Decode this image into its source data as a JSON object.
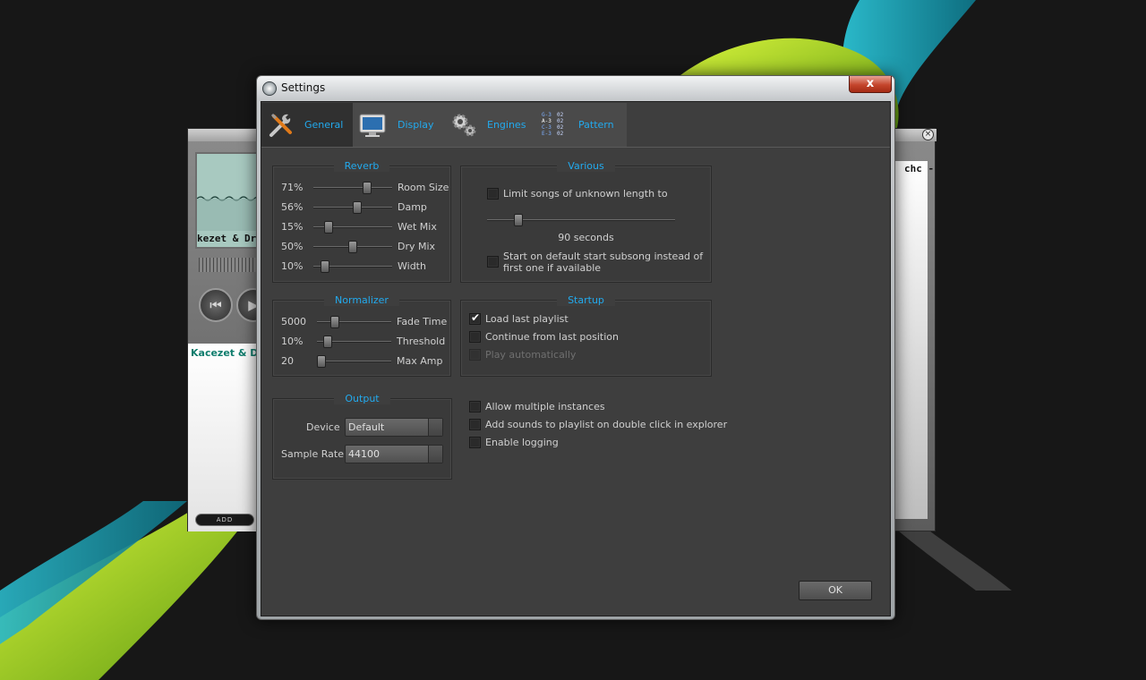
{
  "dialog": {
    "title": "Settings",
    "close_label": "x"
  },
  "tabs": [
    {
      "label": "General",
      "icon": "tools-icon",
      "active": true
    },
    {
      "label": "Display",
      "icon": "monitor-icon",
      "active": false
    },
    {
      "label": "Engines",
      "icon": "gears-icon",
      "active": false
    },
    {
      "label": "Pattern",
      "icon": "pattern-icon",
      "active": false
    }
  ],
  "reverb": {
    "title": "Reverb",
    "rows": [
      {
        "value": "71%",
        "label": "Room Size",
        "level": 0.71
      },
      {
        "value": "56%",
        "label": "Damp",
        "level": 0.56
      },
      {
        "value": "15%",
        "label": "Wet Mix",
        "level": 0.15
      },
      {
        "value": "50%",
        "label": "Dry Mix",
        "level": 0.5
      },
      {
        "value": "10%",
        "label": "Width",
        "level": 0.1
      }
    ]
  },
  "normalizer": {
    "title": "Normalizer",
    "rows": [
      {
        "value": "5000",
        "label": "Fade Time",
        "level": 0.2
      },
      {
        "value": "10%",
        "label": "Threshold",
        "level": 0.1
      },
      {
        "value": "20",
        "label": "Max Amp",
        "level": 0.0
      }
    ]
  },
  "output": {
    "title": "Output",
    "device_label": "Device",
    "device_value": "Default",
    "samplerate_label": "Sample Rate",
    "samplerate_value": "44100"
  },
  "various": {
    "title": "Various",
    "limit_label": "Limit songs of unknown length to",
    "limit_checked": false,
    "seconds_label": "90 seconds",
    "seconds_level": 0.15,
    "default_subsong_line1": "Start on default start subsong instead of",
    "default_subsong_line2": "first one if available",
    "default_subsong_checked": false
  },
  "startup": {
    "title": "Startup",
    "items": [
      {
        "label": "Load last playlist",
        "checked": true,
        "disabled": false
      },
      {
        "label": "Continue from last position",
        "checked": false,
        "disabled": false
      },
      {
        "label": "Play automatically",
        "checked": false,
        "disabled": true
      }
    ]
  },
  "misc": {
    "items": [
      {
        "label": "Allow multiple instances",
        "checked": false
      },
      {
        "label": "Add sounds to playlist on double click in explorer",
        "checked": false
      },
      {
        "label": "Enable logging",
        "checked": false
      }
    ]
  },
  "ok_label": "OK",
  "player": {
    "scope_text": "kezet & Dr",
    "track_title": "Kacezet & Dr",
    "add_label": "ADD",
    "right_text": "chc -"
  },
  "colors": {
    "accent": "#22aaee",
    "dialog_bg": "#3e3e3e",
    "close_red": "#c4452c"
  }
}
